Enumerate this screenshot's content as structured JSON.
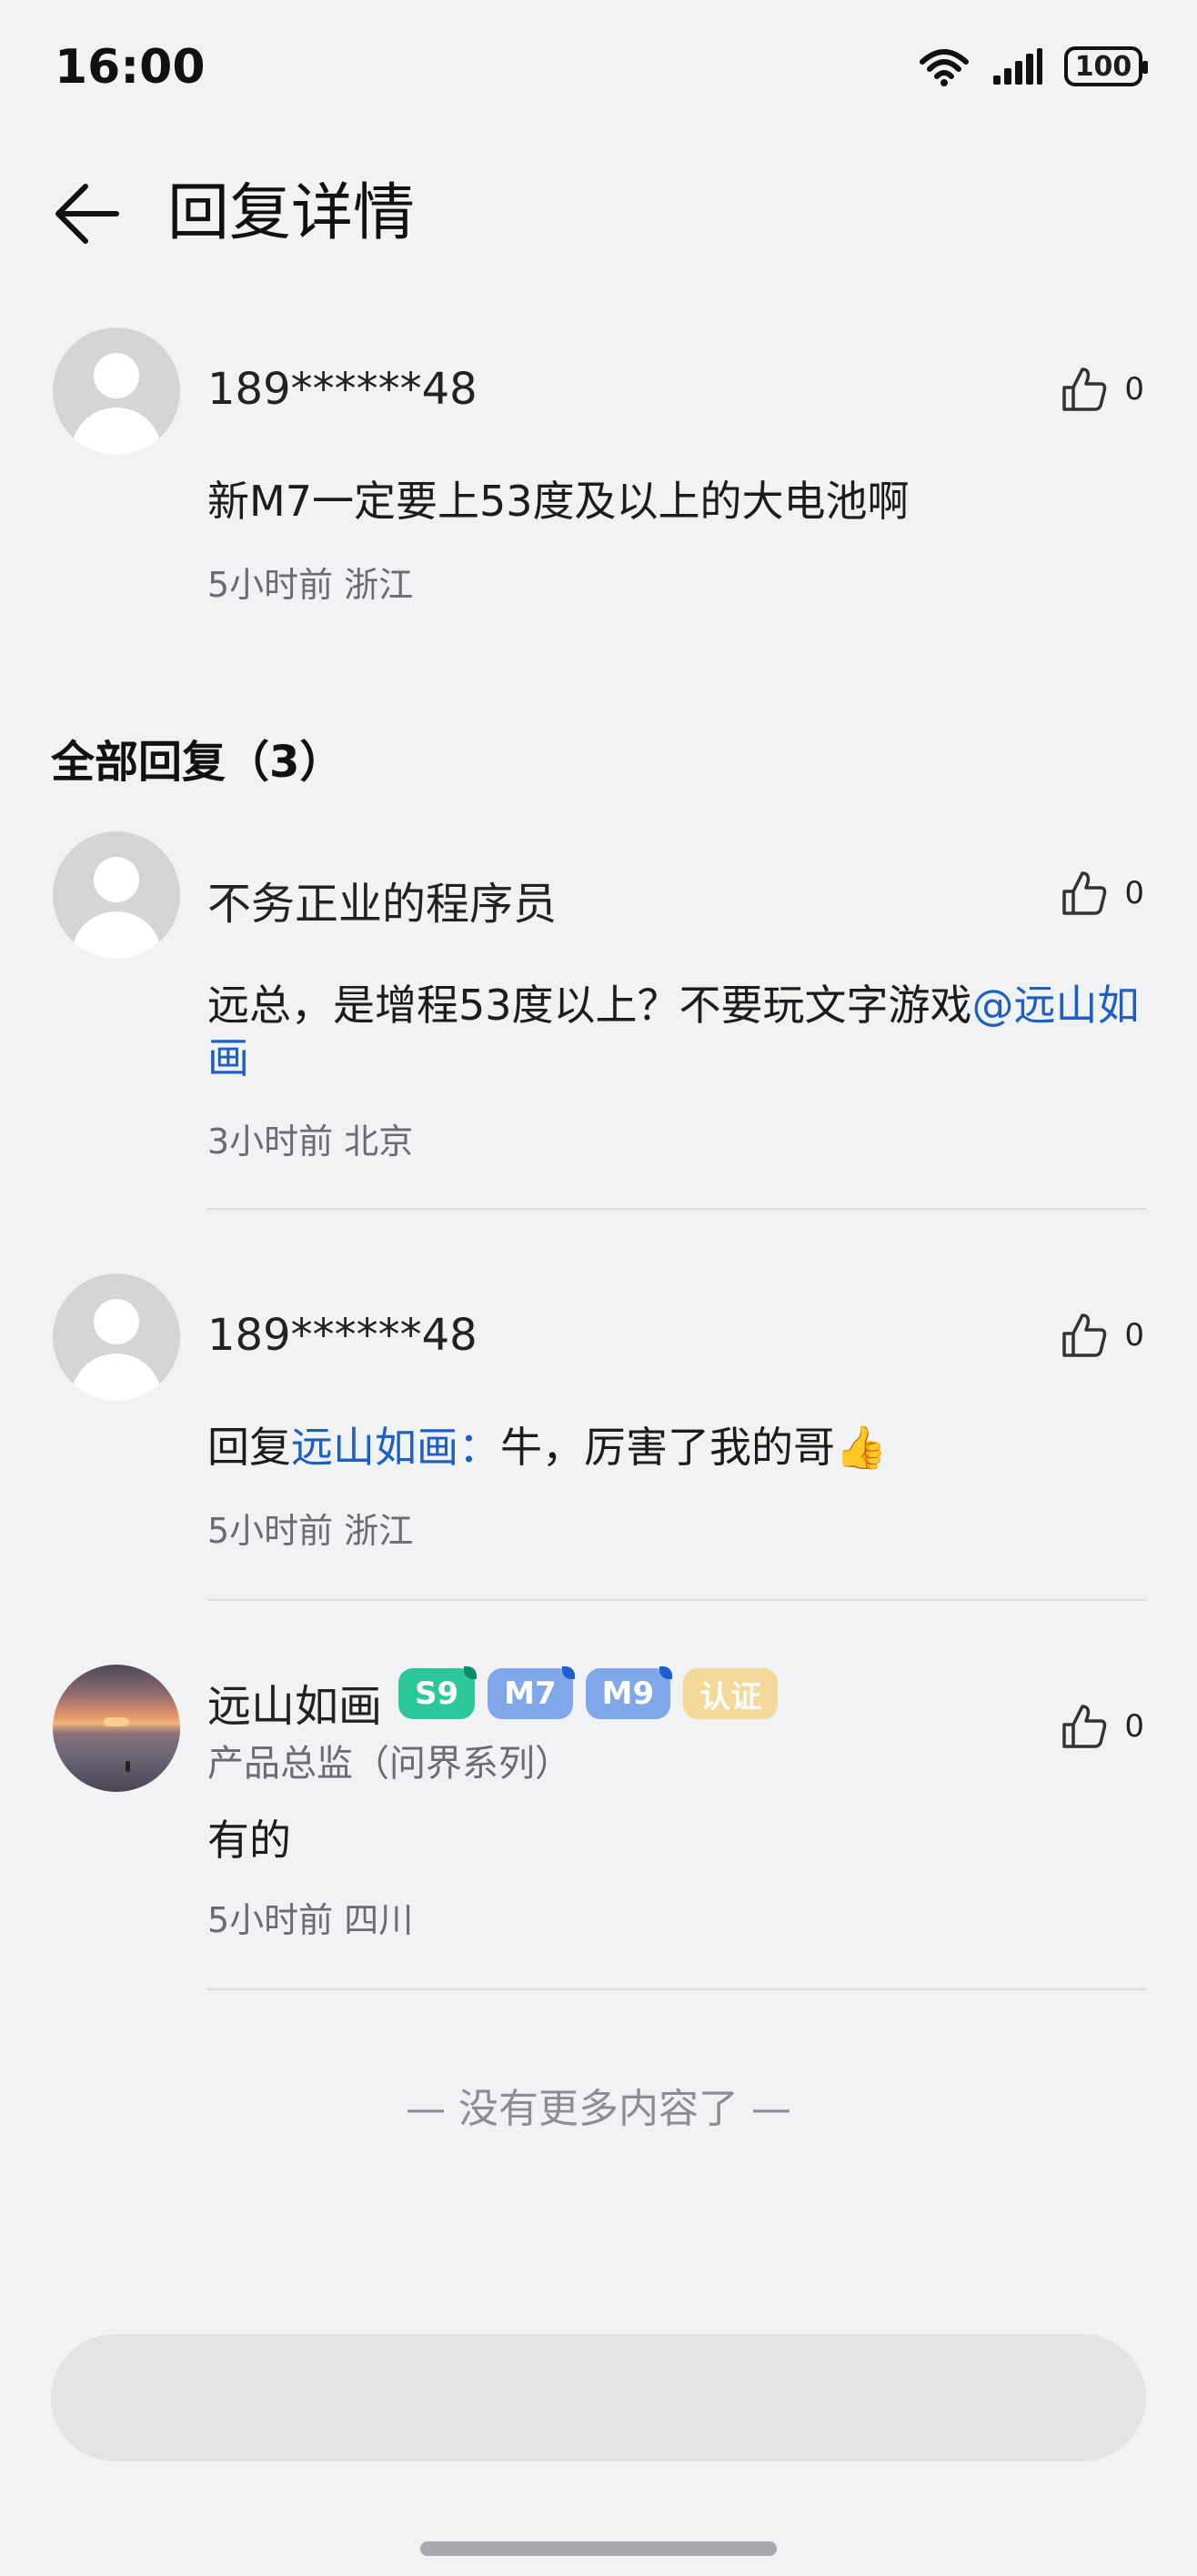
{
  "status_bar": {
    "time": "16:00",
    "battery": "100"
  },
  "header": {
    "title": "回复详情"
  },
  "main_comment": {
    "username": "189******48",
    "content": "新M7一定要上53度及以上的大电池啊",
    "meta": "5小时前 浙江",
    "likes": "0"
  },
  "replies_section": {
    "title": "全部回复（3）"
  },
  "replies": [
    {
      "username": "不务正业的程序员",
      "content_text": "远总，是增程53度以上？不要玩文字游戏",
      "mention": "@远山如画",
      "meta": "3小时前 北京",
      "likes": "0"
    },
    {
      "username": "189******48",
      "reply_prefix": "回复",
      "reply_target": "远山如画：",
      "content_text": "牛，厉害了我的哥👍",
      "meta": "5小时前 浙江",
      "likes": "0"
    },
    {
      "username": "远山如画",
      "badges": [
        "S9",
        "M7",
        "M9",
        "认证"
      ],
      "subtitle": "产品总监（问界系列）",
      "content_text": "有的",
      "meta": "5小时前 四川",
      "likes": "0"
    }
  ],
  "footer": {
    "no_more": "— 没有更多内容了 —"
  },
  "colors": {
    "background": "#f1f2f4",
    "link": "#1d5fc4",
    "badge_s9": "#2cc79a",
    "badge_model": "#7fa7ea",
    "badge_cert": "#f4d99a"
  }
}
